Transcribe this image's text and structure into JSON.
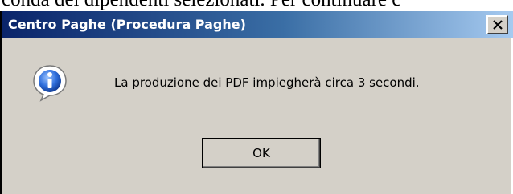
{
  "background": {
    "text": "conda dei dipendenti selezionati. Per continuare c"
  },
  "dialog": {
    "title": "Centro Paghe (Procedura Paghe)",
    "message": "La produzione dei PDF impiegherà circa 3 secondi.",
    "ok_label": "OK",
    "icon": "info-icon",
    "close_icon": "close-icon"
  },
  "colors": {
    "title_bar_start": "#0a246a",
    "title_bar_end": "#a6caf0",
    "dialog_face": "#d4d0c8",
    "icon_blue": "#1f5fd6"
  }
}
